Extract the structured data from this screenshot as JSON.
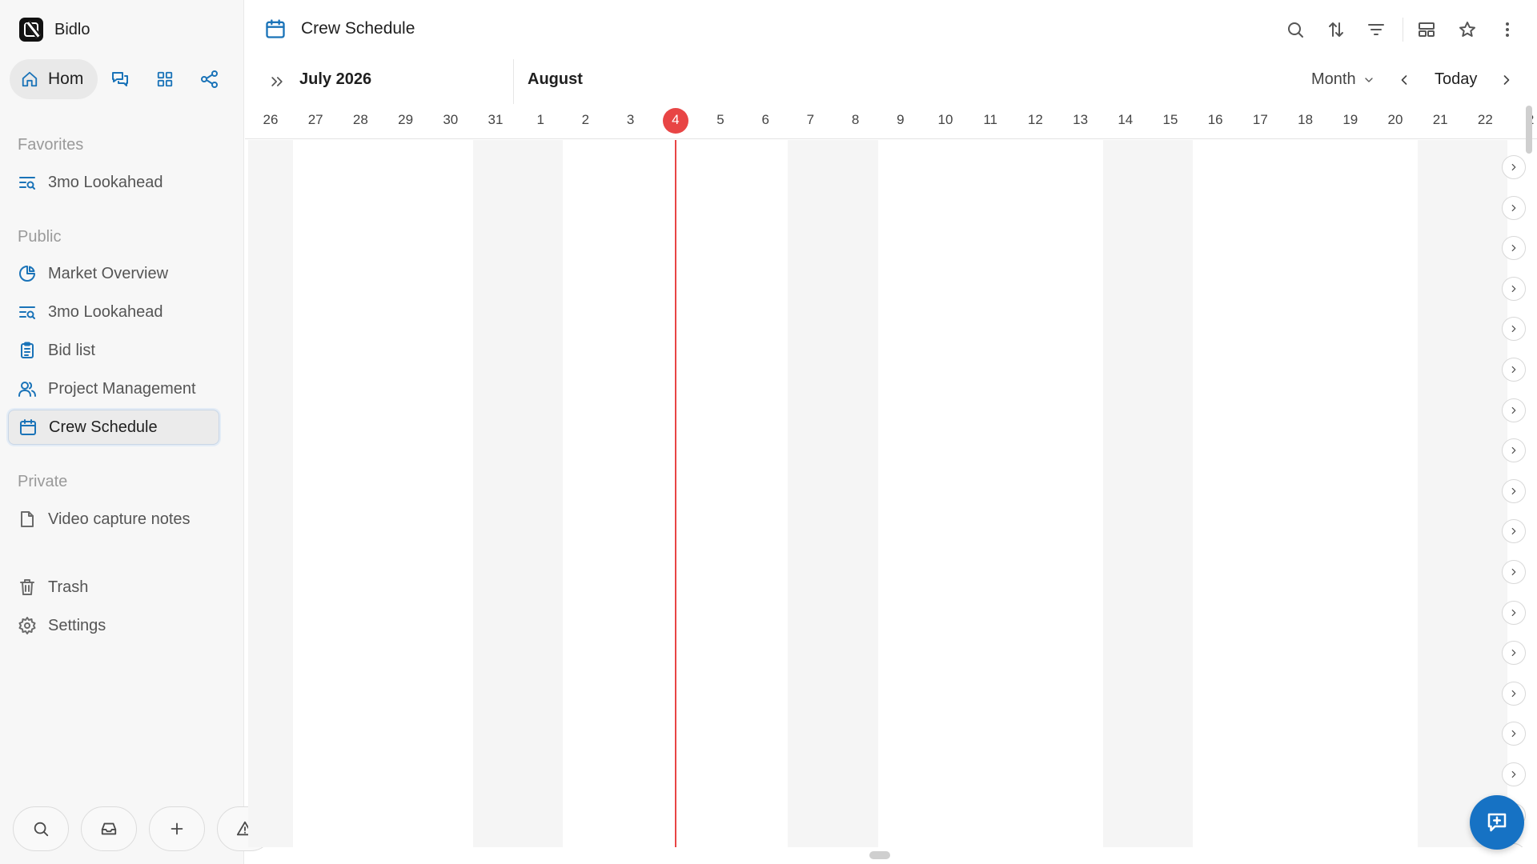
{
  "app": {
    "name": "Bidlo"
  },
  "nav": {
    "home_label": "Hom"
  },
  "sidebar": {
    "favorites_label": "Favorites",
    "favorites": [
      {
        "label": "3mo Lookahead",
        "icon": "lookahead-icon"
      }
    ],
    "public_label": "Public",
    "public_items": [
      {
        "label": "Market Overview",
        "icon": "pie-chart-icon"
      },
      {
        "label": "3mo Lookahead",
        "icon": "lookahead-icon"
      },
      {
        "label": "Bid list",
        "icon": "clipboard-icon"
      },
      {
        "label": "Project Management",
        "icon": "users-icon"
      },
      {
        "label": "Crew Schedule",
        "icon": "calendar-icon",
        "active": true
      }
    ],
    "private_label": "Private",
    "private_items": [
      {
        "label": "Video capture notes",
        "icon": "document-icon"
      }
    ],
    "trash_label": "Trash",
    "settings_label": "Settings"
  },
  "page": {
    "title": "Crew Schedule"
  },
  "calendar": {
    "month_current": "July 2026",
    "month_next": "August",
    "view": "Month",
    "today_label": "Today",
    "today_day": "4",
    "days": [
      "26",
      "27",
      "28",
      "29",
      "30",
      "31",
      "1",
      "2",
      "3",
      "4",
      "5",
      "6",
      "7",
      "8",
      "9",
      "10",
      "11",
      "12",
      "13",
      "14",
      "15",
      "16",
      "17",
      "18",
      "19",
      "20",
      "21",
      "22",
      "2"
    ]
  },
  "colors": {
    "accent": "#1672c4",
    "today": "#e84545",
    "weekend_shade": "#f5f5f5"
  }
}
